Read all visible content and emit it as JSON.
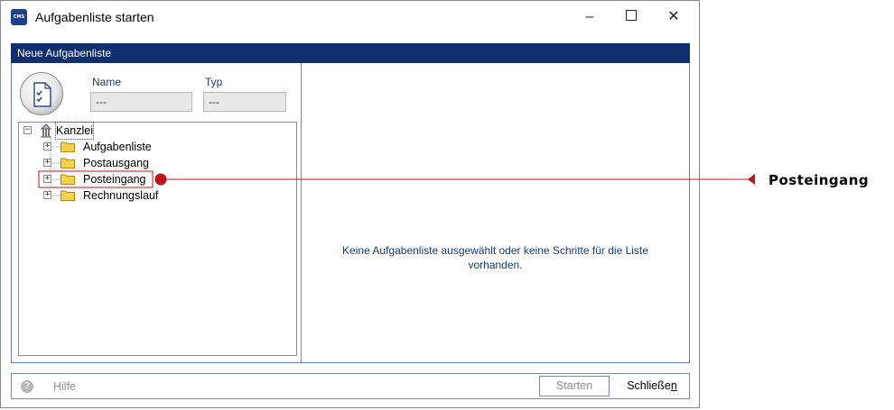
{
  "window": {
    "title": "Aufgabenliste starten",
    "app_icon_text": "CMS",
    "controls": {
      "minimize": "–",
      "close": "✕"
    }
  },
  "section_header": "Neue Aufgabenliste",
  "fields": {
    "name_label": "Name",
    "name_value": "---",
    "typ_label": "Typ",
    "typ_value": "---"
  },
  "tree": {
    "root": {
      "label": "Kanzlei",
      "expander": "−"
    },
    "items": [
      {
        "label": "Aufgabenliste",
        "expander": "+"
      },
      {
        "label": "Postausgang",
        "expander": "+"
      },
      {
        "label": "Posteingang",
        "expander": "+"
      },
      {
        "label": "Rechnungslauf",
        "expander": "+"
      }
    ]
  },
  "empty_message_line1": "Keine Aufgabenliste ausgewählt oder keine Schritte für die Liste",
  "empty_message_line2": "vorhanden.",
  "bottom": {
    "help_label": "Hilfe",
    "help_icon": "?",
    "start_label": "Starten",
    "close_label": "Schließen"
  },
  "callout": {
    "label": "Posteingang",
    "color": "#c0141c"
  },
  "colors": {
    "header_bg": "#0f2f6f",
    "link_text": "#1a3a7a"
  }
}
